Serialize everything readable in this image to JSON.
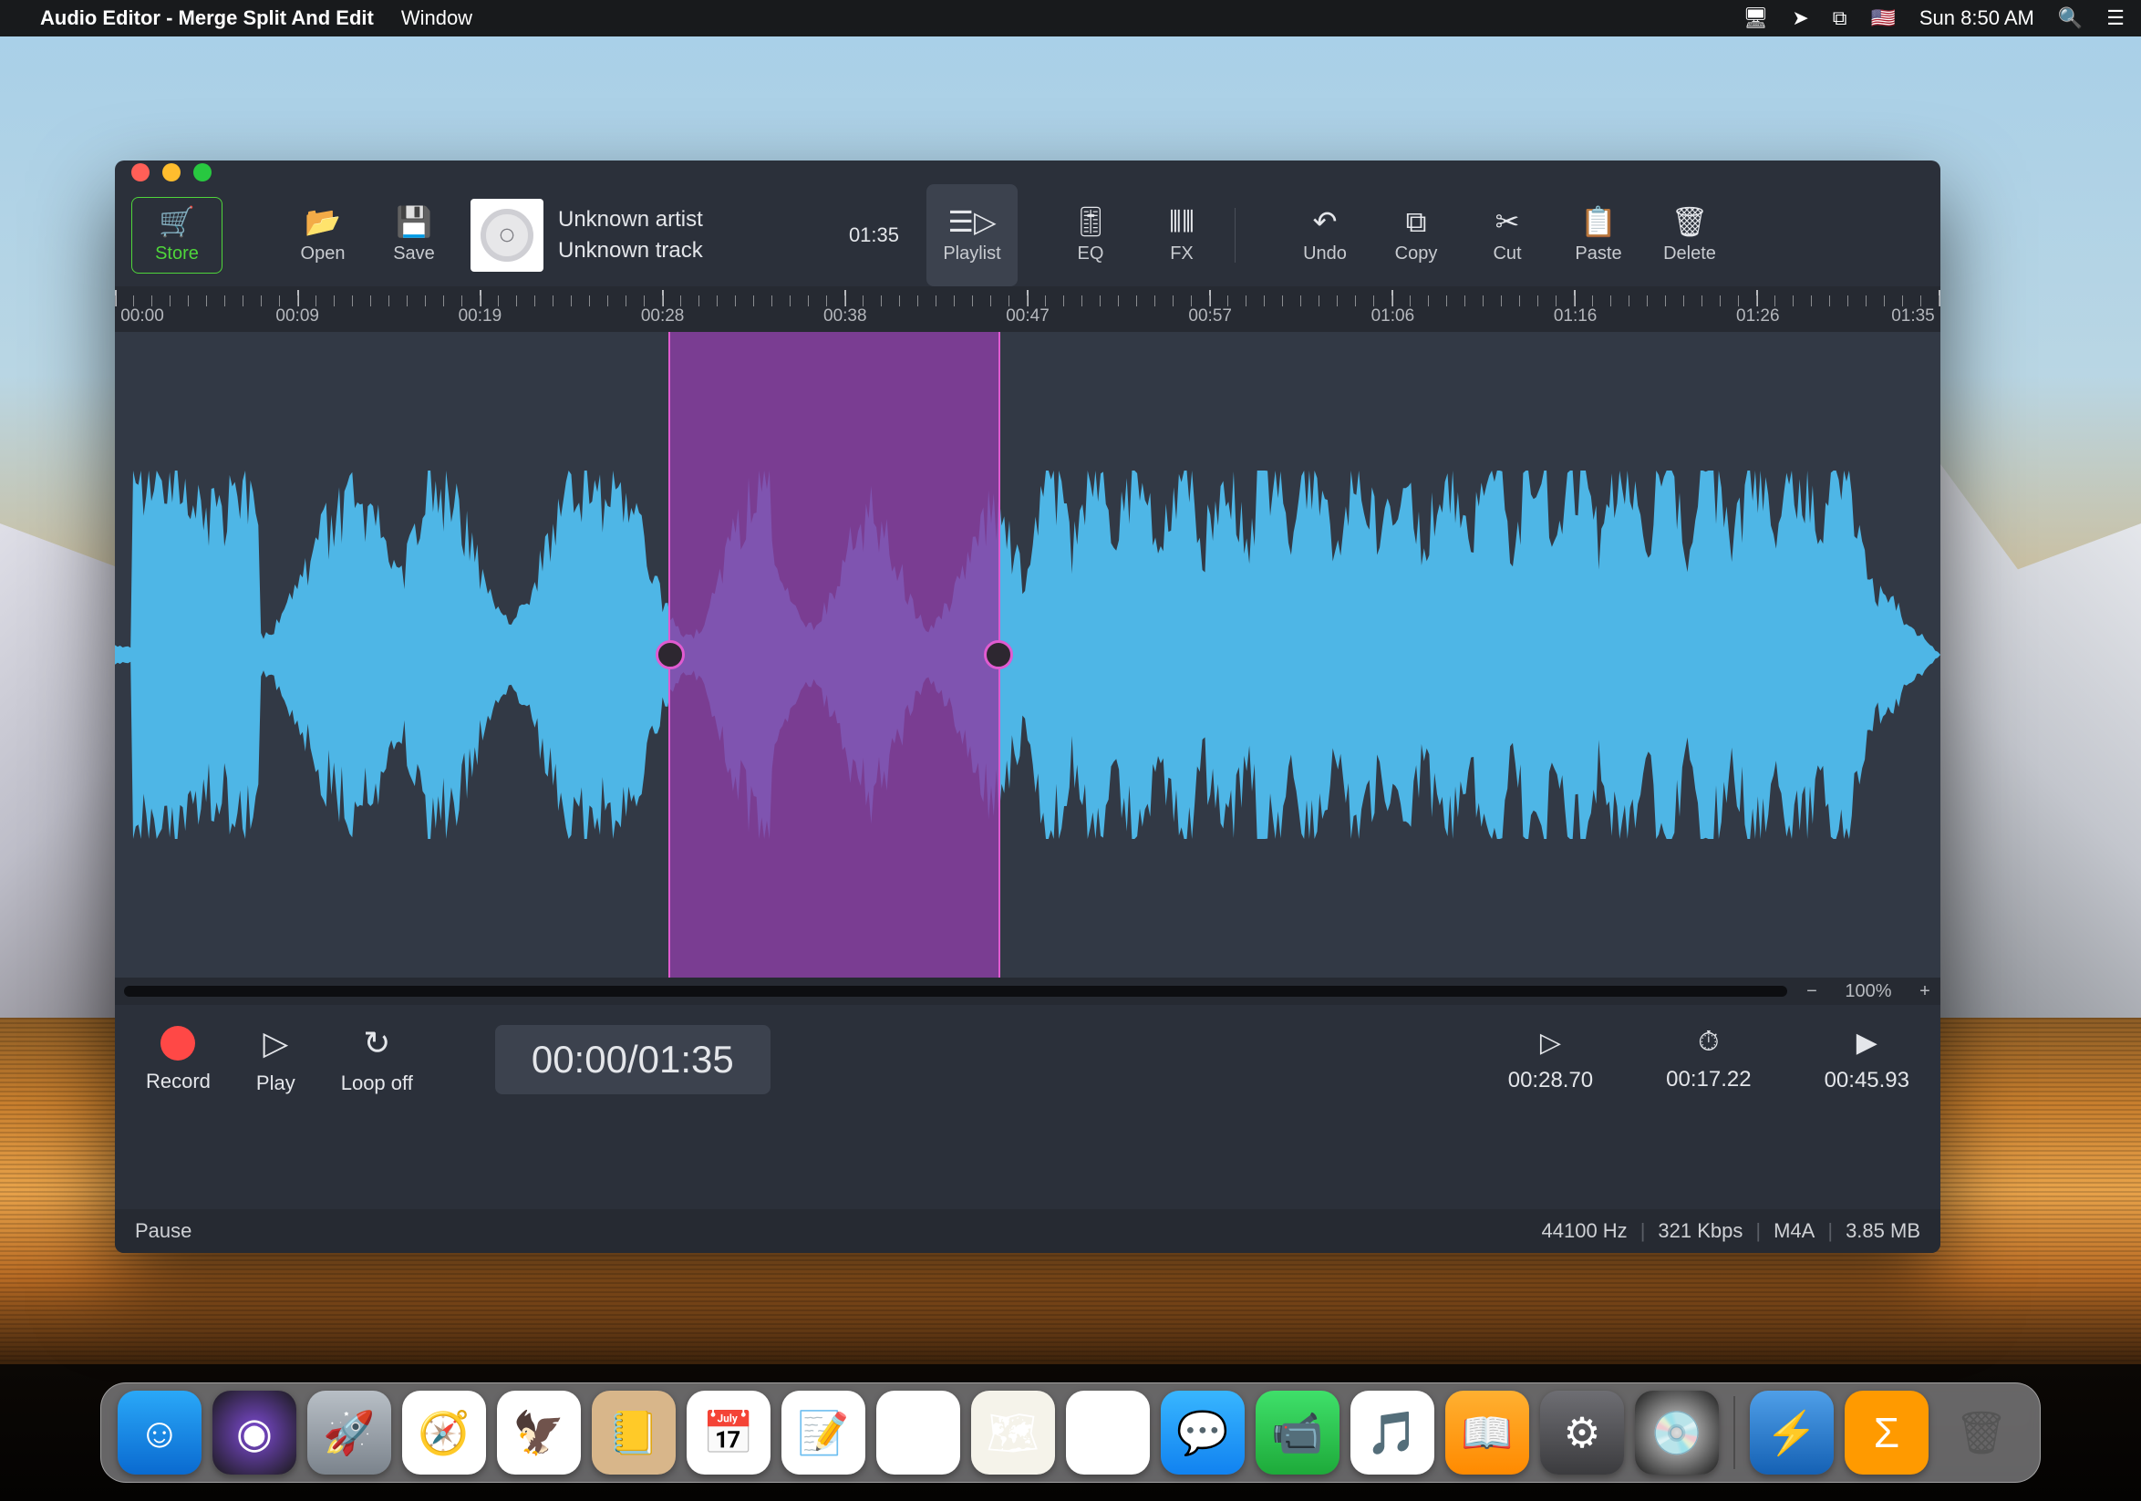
{
  "menubar": {
    "app_name": "Audio Editor - Merge Split And Edit",
    "menus": [
      "Window"
    ],
    "clock": "Sun 8:50 AM"
  },
  "toolbar": {
    "store": "Store",
    "open": "Open",
    "save": "Save",
    "track": {
      "artist": "Unknown artist",
      "title": "Unknown track",
      "duration": "01:35"
    },
    "playlist": "Playlist",
    "eq": "EQ",
    "fx": "FX",
    "undo": "Undo",
    "copy": "Copy",
    "cut": "Cut",
    "paste": "Paste",
    "delete": "Delete"
  },
  "ruler": {
    "labels": [
      "00:00",
      "00:09",
      "00:19",
      "00:28",
      "00:38",
      "00:47",
      "00:57",
      "01:06",
      "01:16",
      "01:26",
      "01:35"
    ]
  },
  "zoom": {
    "minus": "−",
    "plus": "+",
    "pct": "100%"
  },
  "transport": {
    "record": "Record",
    "play": "Play",
    "loop": "Loop off",
    "time": "00:00/01:35",
    "mark_start": "00:28.70",
    "mark_dur": "00:17.22",
    "mark_end": "00:45.93"
  },
  "status": {
    "state": "Pause",
    "rate": "44100 Hz",
    "bitrate": "321 Kbps",
    "format": "M4A",
    "size": "3.85 MB"
  },
  "selection": {
    "start_pct": 30.3,
    "width_pct": 18.2
  },
  "dock": {
    "items": [
      {
        "n": "finder",
        "bg": "linear-gradient(#2aa8f8,#0a6ad0)",
        "g": "☺"
      },
      {
        "n": "siri",
        "bg": "radial-gradient(circle,#7e4bd6,#1a1a1a)",
        "g": "◉"
      },
      {
        "n": "launchpad",
        "bg": "linear-gradient(#b8bfc6,#7b838c)",
        "g": "🚀"
      },
      {
        "n": "safari",
        "bg": "#fff",
        "g": "🧭"
      },
      {
        "n": "mail",
        "bg": "#fff",
        "g": "🦅"
      },
      {
        "n": "contacts",
        "bg": "#d8b68a",
        "g": "📒"
      },
      {
        "n": "calendar",
        "bg": "#fff",
        "g": "📅"
      },
      {
        "n": "notes",
        "bg": "#fff",
        "g": "📝"
      },
      {
        "n": "reminders",
        "bg": "#fff",
        "g": "▤"
      },
      {
        "n": "maps",
        "bg": "#f5f3ea",
        "g": "🗺"
      },
      {
        "n": "photos",
        "bg": "#fff",
        "g": "❀"
      },
      {
        "n": "messages",
        "bg": "linear-gradient(#38b6ff,#1182f0)",
        "g": "💬"
      },
      {
        "n": "facetime",
        "bg": "linear-gradient(#3fe06a,#1eaa3a)",
        "g": "📹"
      },
      {
        "n": "itunes",
        "bg": "#fff",
        "g": "🎵"
      },
      {
        "n": "ibooks",
        "bg": "linear-gradient(#ffb031,#ff8a00)",
        "g": "📖"
      },
      {
        "n": "settings",
        "bg": "linear-gradient(#6e6e73,#3b3b3e)",
        "g": "⚙"
      },
      {
        "n": "audio-editor",
        "bg": "radial-gradient(circle,#dedede,#1a1a1a)",
        "g": "💿"
      },
      {
        "n": "divider"
      },
      {
        "n": "thunderbolt",
        "bg": "linear-gradient(#4f9fe8,#1561b4)",
        "g": "⚡"
      },
      {
        "n": "sigma",
        "bg": "#ff9a00",
        "g": "Σ"
      },
      {
        "n": "trash",
        "bg": "transparent",
        "g": "🗑"
      }
    ]
  }
}
